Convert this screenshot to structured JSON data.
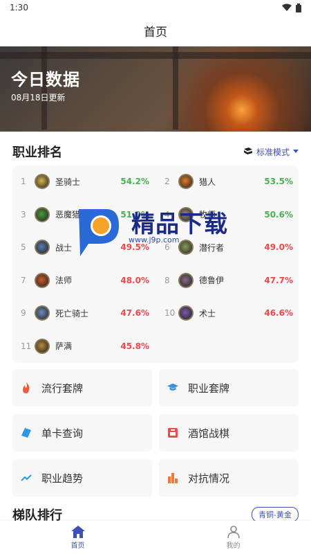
{
  "status": {
    "time": "1:30"
  },
  "app_bar": {
    "title": "首页"
  },
  "banner": {
    "title": "今日数据",
    "subtitle": "08月18日更新"
  },
  "class_ranking": {
    "title": "职业排名",
    "mode": "标准模式",
    "items": [
      {
        "rank": "1",
        "name": "圣骑士",
        "pct": "54.2%",
        "trend": "up",
        "color": "#d8b24a"
      },
      {
        "rank": "2",
        "name": "猎人",
        "pct": "53.5%",
        "trend": "up",
        "color": "#e07b2a"
      },
      {
        "rank": "3",
        "name": "恶魔猎手",
        "pct": "51.0%",
        "trend": "up",
        "color": "#4a9a3a"
      },
      {
        "rank": "4",
        "name": "牧师",
        "pct": "50.6%",
        "trend": "up",
        "color": "#9a8a7a"
      },
      {
        "rank": "5",
        "name": "战士",
        "pct": "49.5%",
        "trend": "down",
        "color": "#5a7aa8"
      },
      {
        "rank": "6",
        "name": "潜行者",
        "pct": "49.0%",
        "trend": "down",
        "color": "#8a9a5a"
      },
      {
        "rank": "7",
        "name": "法师",
        "pct": "48.0%",
        "trend": "down",
        "color": "#c85a2a"
      },
      {
        "rank": "8",
        "name": "德鲁伊",
        "pct": "47.7%",
        "trend": "down",
        "color": "#8a6a8a"
      },
      {
        "rank": "9",
        "name": "死亡骑士",
        "pct": "47.6%",
        "trend": "down",
        "color": "#6a8ab8"
      },
      {
        "rank": "10",
        "name": "术士",
        "pct": "46.6%",
        "trend": "down",
        "color": "#7a5aa8"
      },
      {
        "rank": "11",
        "name": "萨满",
        "pct": "45.8%",
        "trend": "down",
        "color": "#b8883a"
      }
    ]
  },
  "tiles": [
    {
      "label": "流行套牌",
      "icon": "fire-icon",
      "color": "#f15a3a"
    },
    {
      "label": "职业套牌",
      "icon": "graduation-cap-icon",
      "color": "#3a8ee6"
    },
    {
      "label": "单卡查询",
      "icon": "card-icon",
      "color": "#2a9ae6"
    },
    {
      "label": "酒馆战棋",
      "icon": "tavern-icon",
      "color": "#f04a4a"
    },
    {
      "label": "职业趋势",
      "icon": "trend-icon",
      "color": "#2a9ae6"
    },
    {
      "label": "对抗情况",
      "icon": "bar-chart-icon",
      "color": "#f07a3a"
    }
  ],
  "ladder": {
    "title": "梯队排行",
    "badge": "青铜-黄金"
  },
  "bottom_nav": [
    {
      "label": "首页",
      "icon": "home-icon",
      "active": true
    },
    {
      "label": "我的",
      "icon": "profile-icon",
      "active": false
    }
  ],
  "watermark": {
    "text": "精品下载",
    "url": "www.j9p.com"
  }
}
